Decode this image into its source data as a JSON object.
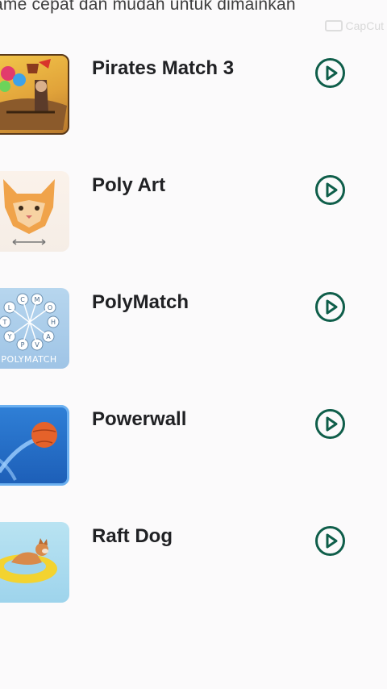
{
  "header": {
    "subtitle": "ame cepat dan mudah untuk dimainkan"
  },
  "watermark": {
    "text": "CapCut"
  },
  "games": [
    {
      "title": "Pirates Match 3",
      "thumbnail_icon": "pirates-match-3-thumbnail",
      "action_icon": "play-circle-icon"
    },
    {
      "title": "Poly Art",
      "thumbnail_icon": "poly-art-cat-thumbnail",
      "action_icon": "play-circle-icon"
    },
    {
      "title": "PolyMatch",
      "thumbnail_icon": "polymatch-letters-thumbnail",
      "thumbnail_text": "POLYMATCH",
      "action_icon": "play-circle-icon"
    },
    {
      "title": "Powerwall",
      "thumbnail_icon": "powerwall-ball-thumbnail",
      "action_icon": "play-circle-icon"
    },
    {
      "title": "Raft Dog",
      "thumbnail_icon": "raft-dog-thumbnail",
      "action_icon": "play-circle-icon"
    }
  ],
  "colors": {
    "background": "#fbfafb",
    "play_accent": "#0f5e4a",
    "title_text": "#202124"
  }
}
